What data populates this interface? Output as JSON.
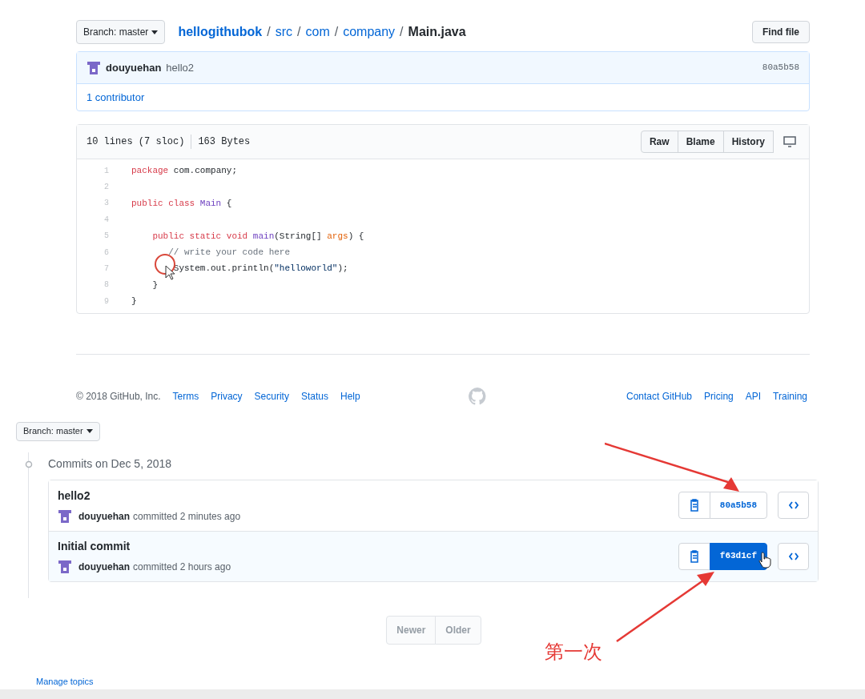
{
  "file_page": {
    "branch_button": "Branch: master",
    "breadcrumb": [
      {
        "label": "hellogithubok",
        "kind": "repo"
      },
      {
        "label": "/",
        "kind": "separator"
      },
      {
        "label": "src",
        "kind": "link"
      },
      {
        "label": "/",
        "kind": "separator"
      },
      {
        "label": "com",
        "kind": "link"
      },
      {
        "label": "/",
        "kind": "separator"
      },
      {
        "label": "company",
        "kind": "link"
      },
      {
        "label": "/",
        "kind": "separator"
      },
      {
        "label": "Main.java",
        "kind": "current"
      }
    ],
    "find_file_button": "Find file",
    "latest_commit": {
      "author": "douyuehan",
      "message": "hello2",
      "hash": "80a5b58"
    },
    "contributors": "1 contributor",
    "file_info": {
      "lines": "10 lines (7 sloc)",
      "size": "163 Bytes",
      "buttons": [
        "Raw",
        "Blame",
        "History"
      ]
    },
    "code": [
      {
        "number": "1",
        "tokens": [
          {
            "text": "package",
            "kind": "keyword"
          },
          {
            "text": " com.company;",
            "kind": "plain"
          }
        ]
      },
      {
        "number": "2"
      },
      {
        "number": "3",
        "tokens": [
          {
            "text": "public class",
            "kind": "keyword"
          },
          {
            "text": " Main",
            "kind": "name"
          },
          {
            "text": " {",
            "kind": "plain"
          }
        ]
      },
      {
        "number": "4"
      },
      {
        "number": "5",
        "tokens": [
          {
            "text": "    public static void",
            "kind": "keyword"
          },
          {
            "text": " main",
            "kind": "name"
          },
          {
            "text": "(String[] ",
            "kind": "plain"
          },
          {
            "text": "args",
            "kind": "param"
          },
          {
            "text": ") {",
            "kind": "plain"
          }
        ]
      },
      {
        "number": "6",
        "tokens": [
          {
            "text": "       // write your code here",
            "kind": "comment"
          }
        ]
      },
      {
        "number": "7",
        "tokens": [
          {
            "text": "        System.out.println(",
            "kind": "plain"
          },
          {
            "text": "\"helloworld\"",
            "kind": "string"
          },
          {
            "text": ");",
            "kind": "plain"
          }
        ]
      },
      {
        "number": "8",
        "tokens": [
          {
            "text": "    }",
            "kind": "plain"
          }
        ]
      },
      {
        "number": "9",
        "tokens": [
          {
            "text": "}",
            "kind": "plain"
          }
        ]
      }
    ],
    "footer": {
      "copyright": "© 2018 GitHub, Inc.",
      "left_links": [
        "Terms",
        "Privacy",
        "Security",
        "Status",
        "Help"
      ],
      "right_links": [
        "Contact GitHub",
        "Pricing",
        "API",
        "Training"
      ]
    }
  },
  "commits_page": {
    "branch_button": "Branch: master",
    "group_title": "Commits on Dec 5, 2018",
    "commits": [
      {
        "message": "hello2",
        "author": "douyuehan",
        "meta": "committed 2 minutes ago",
        "hash": "80a5b58",
        "highlighted": false
      },
      {
        "message": "Initial commit",
        "author": "douyuehan",
        "meta": "committed 2 hours ago",
        "hash": "f63d1cf",
        "highlighted": true
      }
    ],
    "pagination": [
      {
        "label": "Newer",
        "disabled": true
      },
      {
        "label": "Older",
        "disabled": true
      }
    ],
    "manage_topics": "Manage topics"
  },
  "annotation": {
    "label": "第一次"
  }
}
